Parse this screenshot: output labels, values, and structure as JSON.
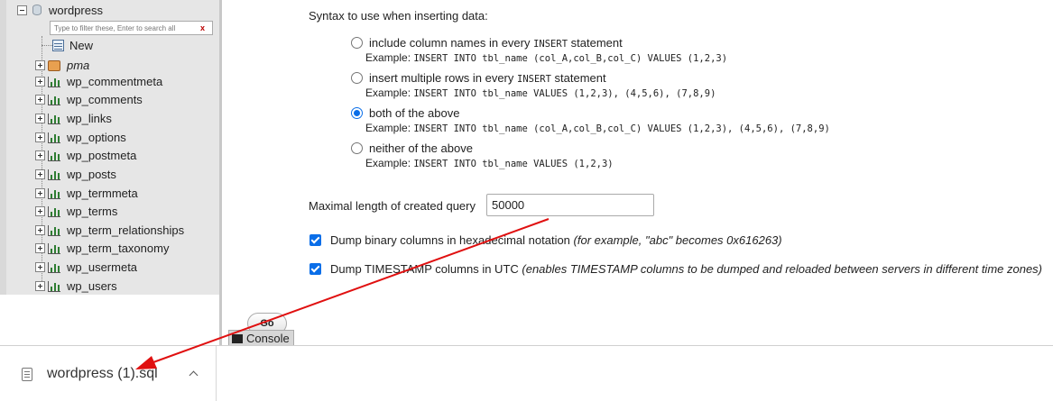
{
  "sidebar": {
    "database": "wordpress",
    "filter_placeholder": "Type to filter these, Enter to search all",
    "filter_clear": "x",
    "new_label": "New",
    "items": [
      {
        "label": "pma",
        "italic": true
      },
      {
        "label": "wp_commentmeta"
      },
      {
        "label": "wp_comments"
      },
      {
        "label": "wp_links"
      },
      {
        "label": "wp_options"
      },
      {
        "label": "wp_postmeta"
      },
      {
        "label": "wp_posts"
      },
      {
        "label": "wp_termmeta"
      },
      {
        "label": "wp_terms"
      },
      {
        "label": "wp_term_relationships"
      },
      {
        "label": "wp_term_taxonomy"
      },
      {
        "label": "wp_usermeta"
      },
      {
        "label": "wp_users"
      }
    ]
  },
  "main": {
    "syntax_title": "Syntax to use when inserting data:",
    "options": [
      {
        "pre": "include column names in every ",
        "kw": "INSERT",
        "post": " statement",
        "example_label": "Example: ",
        "example_code": "INSERT INTO tbl_name (col_A,col_B,col_C) VALUES (1,2,3)",
        "checked": false
      },
      {
        "pre": "insert multiple rows in every ",
        "kw": "INSERT",
        "post": " statement",
        "example_label": "Example: ",
        "example_code": "INSERT INTO tbl_name VALUES (1,2,3), (4,5,6), (7,8,9)",
        "checked": false
      },
      {
        "pre": "both of the above",
        "kw": "",
        "post": "",
        "example_label": "Example: ",
        "example_code": "INSERT INTO tbl_name (col_A,col_B,col_C) VALUES (1,2,3), (4,5,6), (7,8,9)",
        "checked": true
      },
      {
        "pre": "neither of the above",
        "kw": "",
        "post": "",
        "example_label": "Example: ",
        "example_code": "INSERT INTO tbl_name VALUES (1,2,3)",
        "checked": false
      }
    ],
    "maxlen_label": "Maximal length of created query",
    "maxlen_value": "50000",
    "dump_binary_label": "Dump binary columns in hexadecimal notation ",
    "dump_binary_note": "(for example, \"abc\" becomes 0x616263)",
    "dump_ts_label": "Dump TIMESTAMP columns in UTC ",
    "dump_ts_note": "(enables TIMESTAMP columns to be dumped and reloaded between servers in different time zones)",
    "go_label": "Go",
    "console_label": "Console"
  },
  "downloads": {
    "filename": "wordpress (1).sql",
    "file_icon": "file-icon",
    "chevron_icon": "chevron-up-icon"
  },
  "colors": {
    "accent": "#0a6ee8",
    "annotation_arrow": "#e01010"
  }
}
